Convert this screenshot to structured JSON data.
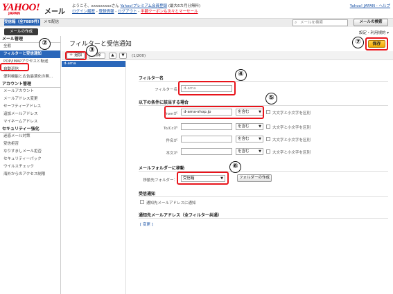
{
  "header": {
    "logo": "YAHOO!",
    "logo_sub": "JAPAN",
    "service": "メール",
    "greeting": "ようこそ、xxxxxxxxxさん",
    "premium_link": "Yahoo!プレミアム会員登録",
    "premium_note": "(最大6カ月分無料)",
    "login_history": "ログイン履歴",
    "login_info": "登録情報",
    "logout": "ログアウト",
    "promo": "半額クーポンも次々とマーセール",
    "right_links": "Yahoo! JAPAN - ヘルプ"
  },
  "topbar": {
    "inbox_tab": "受信箱（全7889件）",
    "draft_tab": "メモ配信",
    "search_placeholder": "メールを検索",
    "search_button": "メールの検索"
  },
  "compose_button": "メールの作成",
  "settings_link": "設定・利用規約 ▾",
  "nav": {
    "sections": [
      {
        "title": "メール管理",
        "items": [
          "全般",
          "フィルターと受信通知",
          "POP/IMAPアクセスと転送",
          "自動返信",
          "便利機能と広告最適化の無..."
        ]
      },
      {
        "title": "アカウント管理",
        "items": [
          "メールアカウント",
          "メールアドレス変更",
          "セーフティーアドレス",
          "追加メールアドレス",
          "マイネームアドレス"
        ]
      },
      {
        "title": "セキュリティー強化",
        "items": [
          "迷惑メール対策",
          "受信拒否",
          "なりすましメール拒否",
          "セキュリティーパック",
          "ウイルスチェック",
          "海外からのアクセス制限"
        ]
      }
    ],
    "active_index": 1
  },
  "page": {
    "title": "フィルターと受信通知",
    "save_button": "保存"
  },
  "toolbar": {
    "add_button": "＋ 追加",
    "delete_button": "削除",
    "up_arrow": "▲",
    "down_arrow": "▼",
    "count": "(1/200)"
  },
  "filter_list": [
    "d-ama"
  ],
  "form": {
    "filter_name_section": "フィルター名",
    "filter_name_label": "フィルター名",
    "filter_name_value": "d-ama",
    "conditions_section": "以下の条件に該当する場合",
    "conditions": [
      {
        "label": "Fromが",
        "value": "d-ama-shop.jp",
        "operator": "を含む"
      },
      {
        "label": "To/Ccが",
        "value": "",
        "operator": "を含む"
      },
      {
        "label": "件名が",
        "value": "",
        "operator": "を含む"
      },
      {
        "label": "本文が",
        "value": "",
        "operator": "を含む"
      }
    ],
    "case_label": "大文字と小文字を区別",
    "move_section": "メールフォルダーに移動",
    "move_label": "移動先フォルダー：",
    "move_folder": "受信箱",
    "create_folder_button": "フォルダーの作成",
    "notify_section": "受信通知",
    "notify_checkbox": "通知先メールアドレスに通知",
    "notify_address_section": "通知先メールアドレス（全フィルター共通）",
    "change_link": "[ 変更 ]"
  },
  "annotations": [
    "②",
    "③",
    "④",
    "⑤",
    "⑥",
    "⑦"
  ],
  "colors": {
    "highlight": "#e8141b",
    "brand_red": "#e60012",
    "active_blue": "#2a67ba",
    "save_yellow": "#f2a900"
  }
}
